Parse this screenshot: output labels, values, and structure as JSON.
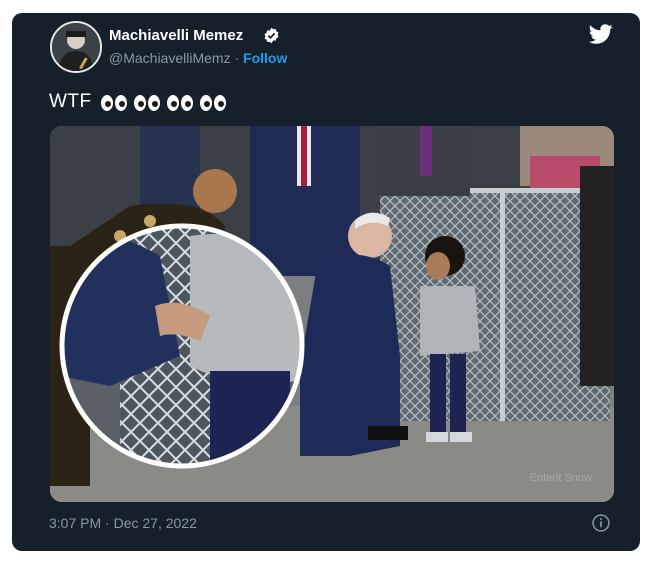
{
  "tweet": {
    "display_name": "Machiavelli Memez",
    "handle": "@MachiavelliMemz",
    "separator": "·",
    "follow_label": "Follow",
    "text": "WTF",
    "emoji_names": [
      "eyes-emoji",
      "eyes-emoji",
      "eyes-emoji",
      "eyes-emoji"
    ],
    "time": "3:07 PM",
    "date": "Dec 27, 2022",
    "watermark": "Enterit Snow"
  },
  "colors": {
    "card_bg": "#15202b",
    "accent": "#1d9bf0",
    "secondary_text": "#8899a6",
    "primary_text": "#ffffff"
  },
  "icons": {
    "verified": "verified-badge-icon",
    "platform": "twitter-bird-icon",
    "info": "info-icon"
  }
}
